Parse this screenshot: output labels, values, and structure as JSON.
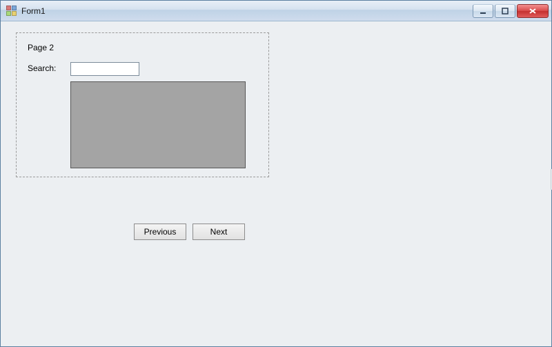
{
  "window": {
    "title": "Form1"
  },
  "panel": {
    "page_label": "Page 2",
    "search_label": "Search:",
    "search_value": ""
  },
  "nav": {
    "previous_label": "Previous",
    "next_label": "Next"
  }
}
